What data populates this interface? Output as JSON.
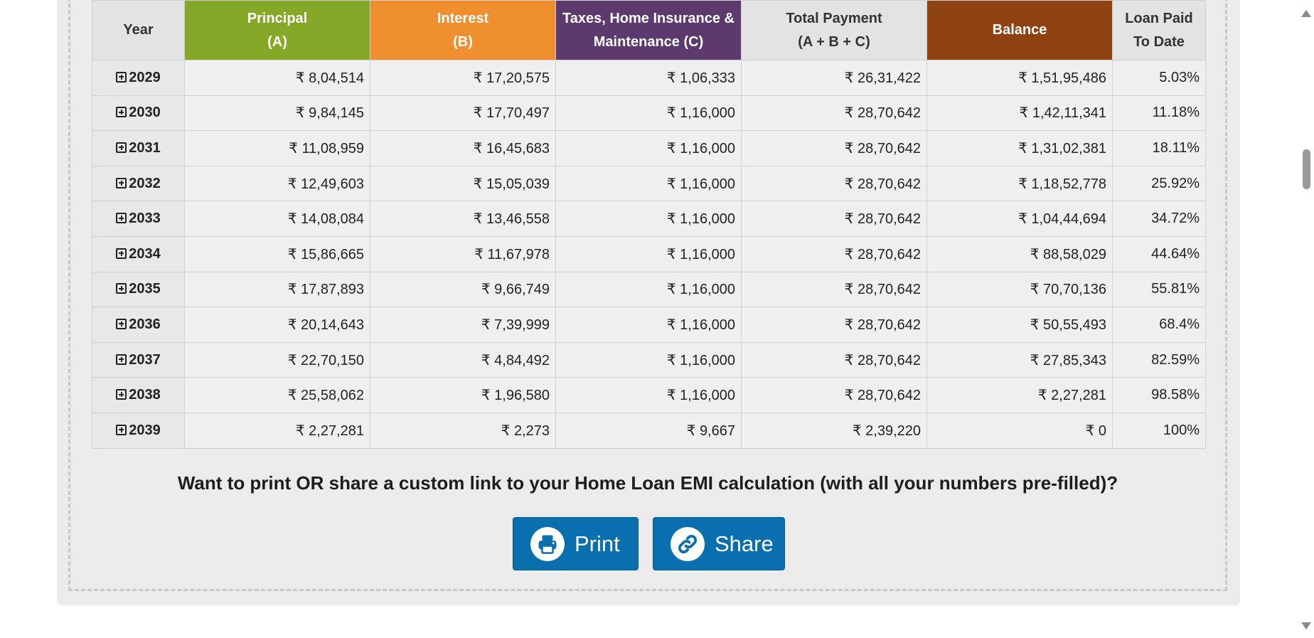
{
  "table": {
    "headers": {
      "year": "Year",
      "principal_line1": "Principal",
      "principal_line2": "(A)",
      "interest_line1": "Interest",
      "interest_line2": "(B)",
      "taxes_line1": "Taxes, Home Insurance &",
      "taxes_line2": "Maintenance (C)",
      "total_line1": "Total Payment",
      "total_line2": "(A + B + C)",
      "balance": "Balance",
      "paid_line1": "Loan Paid",
      "paid_line2": "To Date"
    },
    "rows": [
      {
        "year": "2029",
        "principal": "₹ 8,04,514",
        "interest": "₹ 17,20,575",
        "taxes": "₹ 1,06,333",
        "total": "₹ 26,31,422",
        "balance": "₹ 1,51,95,486",
        "paid": "5.03%"
      },
      {
        "year": "2030",
        "principal": "₹ 9,84,145",
        "interest": "₹ 17,70,497",
        "taxes": "₹ 1,16,000",
        "total": "₹ 28,70,642",
        "balance": "₹ 1,42,11,341",
        "paid": "11.18%"
      },
      {
        "year": "2031",
        "principal": "₹ 11,08,959",
        "interest": "₹ 16,45,683",
        "taxes": "₹ 1,16,000",
        "total": "₹ 28,70,642",
        "balance": "₹ 1,31,02,381",
        "paid": "18.11%"
      },
      {
        "year": "2032",
        "principal": "₹ 12,49,603",
        "interest": "₹ 15,05,039",
        "taxes": "₹ 1,16,000",
        "total": "₹ 28,70,642",
        "balance": "₹ 1,18,52,778",
        "paid": "25.92%"
      },
      {
        "year": "2033",
        "principal": "₹ 14,08,084",
        "interest": "₹ 13,46,558",
        "taxes": "₹ 1,16,000",
        "total": "₹ 28,70,642",
        "balance": "₹ 1,04,44,694",
        "paid": "34.72%"
      },
      {
        "year": "2034",
        "principal": "₹ 15,86,665",
        "interest": "₹ 11,67,978",
        "taxes": "₹ 1,16,000",
        "total": "₹ 28,70,642",
        "balance": "₹ 88,58,029",
        "paid": "44.64%"
      },
      {
        "year": "2035",
        "principal": "₹ 17,87,893",
        "interest": "₹ 9,66,749",
        "taxes": "₹ 1,16,000",
        "total": "₹ 28,70,642",
        "balance": "₹ 70,70,136",
        "paid": "55.81%"
      },
      {
        "year": "2036",
        "principal": "₹ 20,14,643",
        "interest": "₹ 7,39,999",
        "taxes": "₹ 1,16,000",
        "total": "₹ 28,70,642",
        "balance": "₹ 50,55,493",
        "paid": "68.4%"
      },
      {
        "year": "2037",
        "principal": "₹ 22,70,150",
        "interest": "₹ 4,84,492",
        "taxes": "₹ 1,16,000",
        "total": "₹ 28,70,642",
        "balance": "₹ 27,85,343",
        "paid": "82.59%"
      },
      {
        "year": "2038",
        "principal": "₹ 25,58,062",
        "interest": "₹ 1,96,580",
        "taxes": "₹ 1,16,000",
        "total": "₹ 28,70,642",
        "balance": "₹ 2,27,281",
        "paid": "98.58%"
      },
      {
        "year": "2039",
        "principal": "₹ 2,27,281",
        "interest": "₹ 2,273",
        "taxes": "₹ 9,667",
        "total": "₹ 2,39,220",
        "balance": "₹ 0",
        "paid": "100%"
      }
    ]
  },
  "share_section": {
    "prompt": "Want to print OR share a custom link to your Home Loan EMI calculation (with all your numbers pre-filled)?",
    "print_label": "Print",
    "share_label": "Share"
  },
  "icons": {
    "row_toggle": "plus-square-icon",
    "print": "printer-icon",
    "share": "link-icon"
  },
  "colors": {
    "principal": "#86a828",
    "interest": "#ee8e2e",
    "taxes": "#5c3a6e",
    "balance": "#8f4312",
    "button": "#0a6fae"
  }
}
